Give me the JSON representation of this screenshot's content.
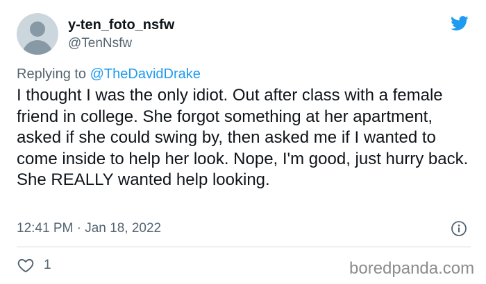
{
  "user": {
    "display_name": "y-ten_foto_nsfw",
    "handle": "@TenNsfw",
    "avatar_icon": "default-avatar-icon"
  },
  "reply": {
    "prefix": "Replying to ",
    "mention": "@TheDavidDrake"
  },
  "tweet": {
    "text": "I thought I was the only idiot. Out after class with a female friend in college. She forgot something at her apartment, asked if she could swing by, then asked me if I wanted to come inside to help her look. Nope, I'm good, just hurry back. She REALLY wanted help looking.",
    "time": "12:41 PM",
    "separator": " · ",
    "date": "Jan 18, 2022"
  },
  "actions": {
    "like_icon": "heart-icon",
    "like_count": "1",
    "info_icon": "info-icon"
  },
  "branding": {
    "platform_icon": "twitter-bird-icon",
    "watermark": "boredpanda.com"
  },
  "colors": {
    "text": "#0f1419",
    "secondary": "#536471",
    "accent": "#1d9bf0",
    "divider": "#cfd9de",
    "watermark": "#8c8c8c"
  }
}
